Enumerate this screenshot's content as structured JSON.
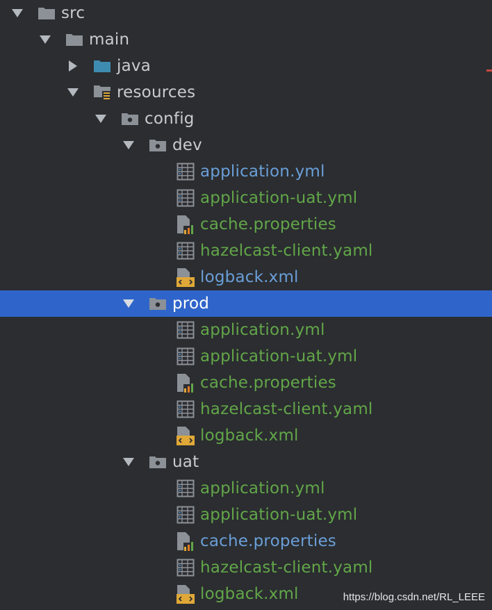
{
  "tree": {
    "nodes": [
      {
        "id": "src",
        "label": "src",
        "depth": 0,
        "expanded": true,
        "icon": "folder-icon",
        "color": "default"
      },
      {
        "id": "main",
        "label": "main",
        "depth": 1,
        "expanded": true,
        "icon": "folder-icon",
        "color": "default"
      },
      {
        "id": "java",
        "label": "java",
        "depth": 2,
        "expanded": false,
        "icon": "source-folder-icon",
        "color": "default"
      },
      {
        "id": "resources",
        "label": "resources",
        "depth": 2,
        "expanded": true,
        "icon": "resources-folder-icon",
        "color": "default"
      },
      {
        "id": "config",
        "label": "config",
        "depth": 3,
        "expanded": true,
        "icon": "package-folder-icon",
        "color": "default"
      },
      {
        "id": "dev",
        "label": "dev",
        "depth": 4,
        "expanded": true,
        "icon": "package-folder-icon",
        "color": "default"
      },
      {
        "id": "dev-application-yml",
        "label": "application.yml",
        "depth": 5,
        "icon": "yaml-file-icon",
        "color": "blue"
      },
      {
        "id": "dev-application-uat-yml",
        "label": "application-uat.yml",
        "depth": 5,
        "icon": "yaml-file-icon",
        "color": "green"
      },
      {
        "id": "dev-cache-properties",
        "label": "cache.properties",
        "depth": 5,
        "icon": "properties-file-icon",
        "color": "green"
      },
      {
        "id": "dev-hazelcast-client-yaml",
        "label": "hazelcast-client.yaml",
        "depth": 5,
        "icon": "yaml-file-icon",
        "color": "green"
      },
      {
        "id": "dev-logback-xml",
        "label": "logback.xml",
        "depth": 5,
        "icon": "xml-file-icon",
        "color": "blue"
      },
      {
        "id": "prod",
        "label": "prod",
        "depth": 4,
        "expanded": true,
        "icon": "package-folder-icon",
        "color": "white",
        "selected": true
      },
      {
        "id": "prod-application-yml",
        "label": "application.yml",
        "depth": 5,
        "icon": "yaml-file-icon",
        "color": "green"
      },
      {
        "id": "prod-application-uat-yml",
        "label": "application-uat.yml",
        "depth": 5,
        "icon": "yaml-file-icon",
        "color": "green"
      },
      {
        "id": "prod-cache-properties",
        "label": "cache.properties",
        "depth": 5,
        "icon": "properties-file-icon",
        "color": "green"
      },
      {
        "id": "prod-hazelcast-client-yaml",
        "label": "hazelcast-client.yaml",
        "depth": 5,
        "icon": "yaml-file-icon",
        "color": "green"
      },
      {
        "id": "prod-logback-xml",
        "label": "logback.xml",
        "depth": 5,
        "icon": "xml-file-icon",
        "color": "green"
      },
      {
        "id": "uat",
        "label": "uat",
        "depth": 4,
        "expanded": true,
        "icon": "package-folder-icon",
        "color": "default"
      },
      {
        "id": "uat-application-yml",
        "label": "application.yml",
        "depth": 5,
        "icon": "yaml-file-icon",
        "color": "green"
      },
      {
        "id": "uat-application-uat-yml",
        "label": "application-uat.yml",
        "depth": 5,
        "icon": "yaml-file-icon",
        "color": "green"
      },
      {
        "id": "uat-cache-properties",
        "label": "cache.properties",
        "depth": 5,
        "icon": "properties-file-icon",
        "color": "blue"
      },
      {
        "id": "uat-hazelcast-client-yaml",
        "label": "hazelcast-client.yaml",
        "depth": 5,
        "icon": "yaml-file-icon",
        "color": "green"
      },
      {
        "id": "uat-logback-xml",
        "label": "logback.xml",
        "depth": 5,
        "icon": "xml-file-icon",
        "color": "green"
      }
    ]
  },
  "watermark": "https://blog.csdn.net/RL_LEEE",
  "colors": {
    "background": "#2b2d30",
    "selection": "#2f65ca",
    "default_text": "#c8cbd0",
    "modified_text": "#6a9fd8",
    "added_text": "#62a649",
    "folder_icon": "#8c9198",
    "source_folder_icon": "#3f8cb1",
    "change_marker": "#c9473f"
  }
}
